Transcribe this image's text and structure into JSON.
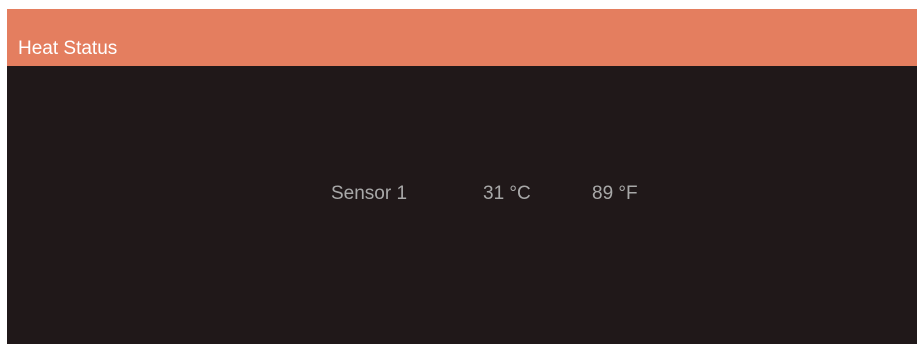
{
  "panel": {
    "title": "Heat Status"
  },
  "sensor": {
    "label": "Sensor 1",
    "celsius": "31 °C",
    "fahrenheit": "89  °F"
  },
  "colors": {
    "header_bg": "#e47e5f",
    "panel_bg": "#201819",
    "title_text": "#ffffff",
    "reading_text": "#a8a8a8"
  }
}
